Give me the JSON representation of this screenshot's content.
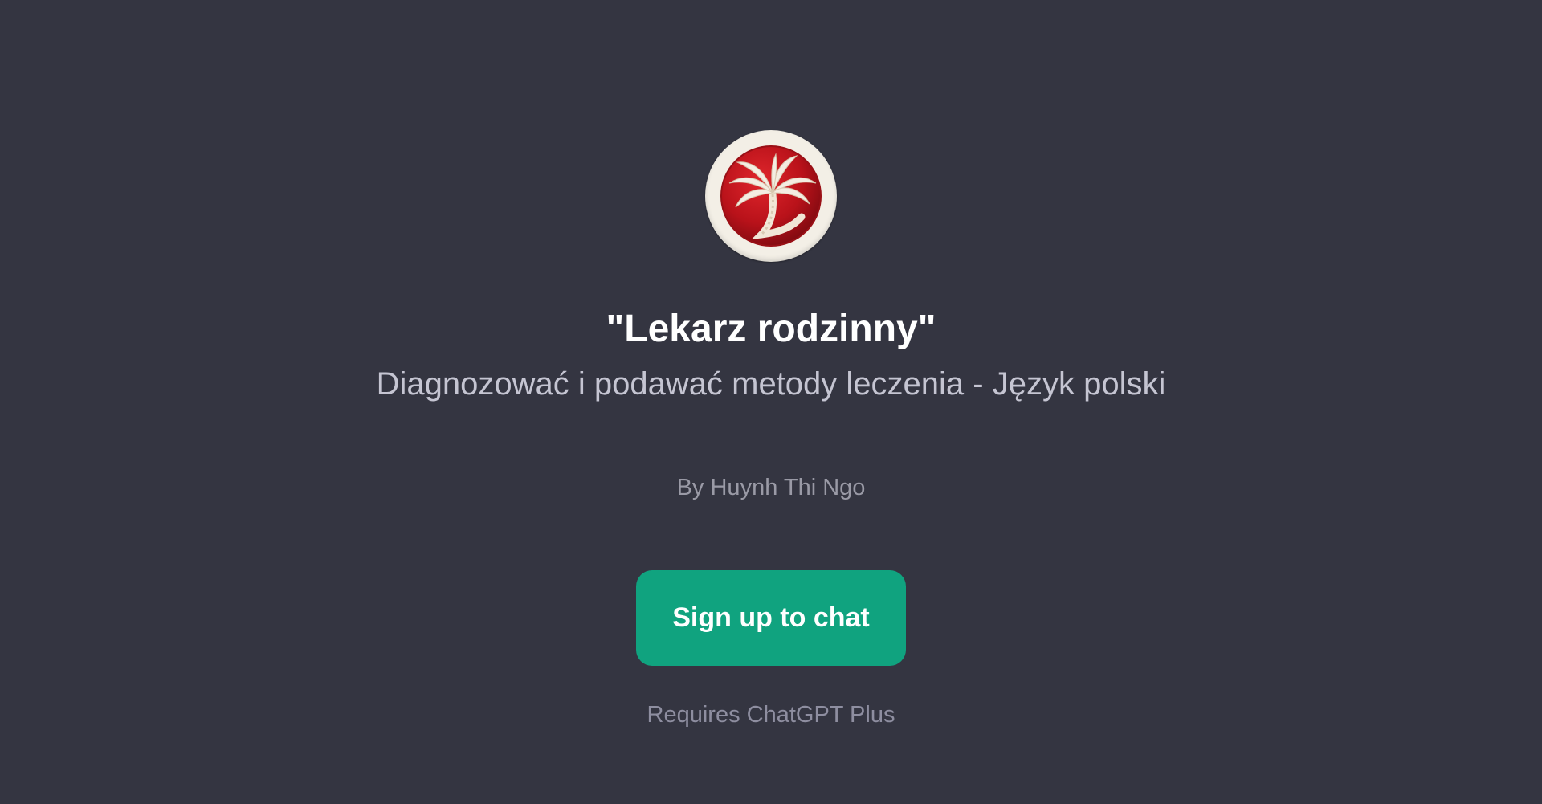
{
  "gpt": {
    "title": "\"Lekarz rodzinny\"",
    "subtitle": "Diagnozować i podawać metody leczenia - Język polski",
    "author": "By Huynh Thi Ngo",
    "avatar_icon": "palm-tree-icon"
  },
  "cta": {
    "signup_label": "Sign up to chat",
    "requirement": "Requires ChatGPT Plus"
  },
  "colors": {
    "background": "#343541",
    "button": "#10a37f",
    "avatar_red": "#c0161c",
    "avatar_ring": "#f3efe6"
  }
}
